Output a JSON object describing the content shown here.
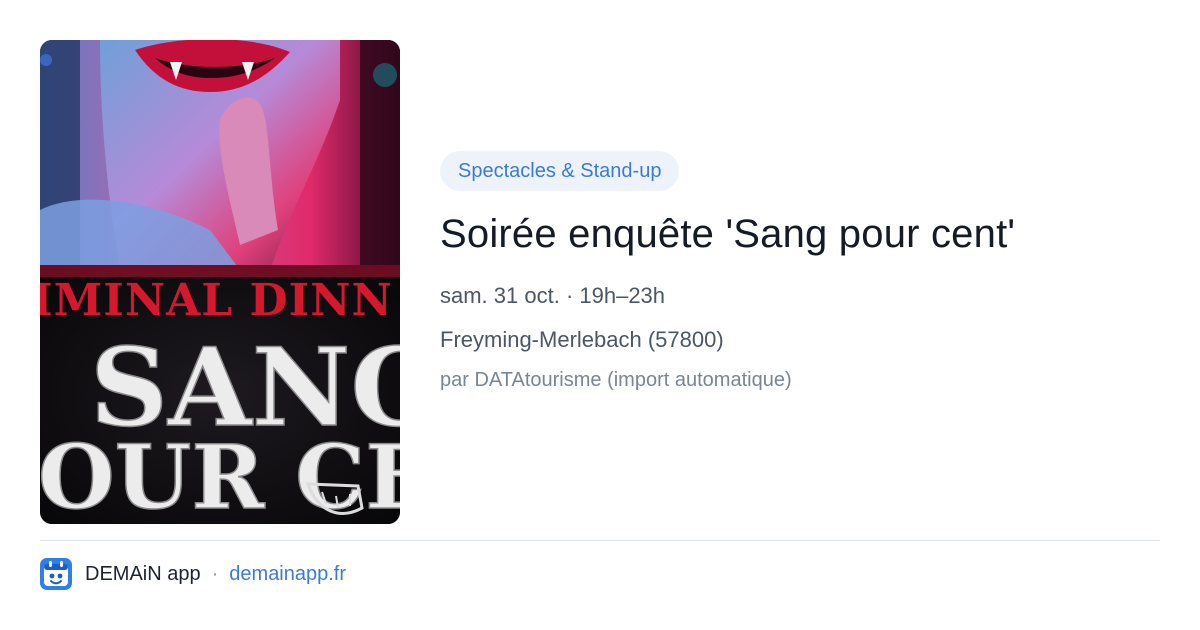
{
  "event": {
    "category": "Spectacles & Stand-up",
    "title": "Soirée enquête 'Sang pour cent'",
    "datetime": "sam. 31 oct. · 19h–23h",
    "location": "Freyming-Merlebach (57800)",
    "source": "par DATAtourisme (import automatique)"
  },
  "poster": {
    "line1": "IMINAL DINN",
    "line2": "SANG",
    "line3": "OUR CEN"
  },
  "footer": {
    "app_name": "DEMAiN app",
    "separator": "·",
    "link": "demainapp.fr"
  },
  "colors": {
    "accent": "#3d7ad6",
    "pill_bg": "#eef3fb",
    "title": "#141a26",
    "meta": "#4b5666",
    "muted": "#7a8594"
  }
}
